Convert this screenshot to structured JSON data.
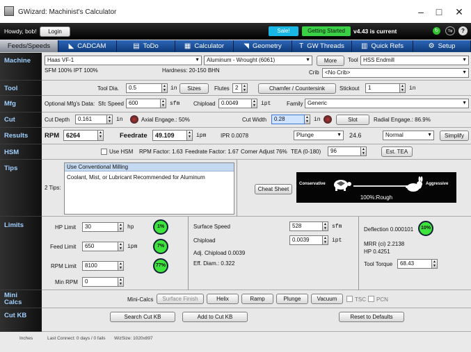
{
  "window": {
    "title": "GWizard: Machinist's Calculator"
  },
  "topbar": {
    "greeting": "Howdy, bob!",
    "login": "Login",
    "sale": "Sale!",
    "getting_started": "Getting Started",
    "version": "v4.43 is current"
  },
  "tabs": [
    {
      "label": "Feeds/Speeds",
      "icon": ""
    },
    {
      "label": "CADCAM",
      "icon": "◣"
    },
    {
      "label": "ToDo",
      "icon": "▤"
    },
    {
      "label": "Calculator",
      "icon": "▦"
    },
    {
      "label": "Geometry",
      "icon": "◥"
    },
    {
      "label": "GW Threads",
      "icon": "T"
    },
    {
      "label": "Quick Refs",
      "icon": "▥"
    },
    {
      "label": "Setup",
      "icon": "⚙"
    }
  ],
  "sections": {
    "machine": "Machine",
    "tool": "Tool",
    "mfg": "Mfg",
    "cut": "Cut",
    "results": "Results",
    "hsm": "HSM",
    "tips": "Tips",
    "limits": "Limits",
    "mini1": "Mini",
    "mini2": "Calcs",
    "cutkb": "Cut KB"
  },
  "machine": {
    "machine_value": "Haas VF-1",
    "material_value": "Aluminum - Wrought (6061)",
    "more": "More",
    "tool_label": "Tool",
    "tool_value": "HSS Endmill",
    "crib_label": "Crib",
    "crib_value": "<No Crib>",
    "sfm_ipt": "SFM 100%  IPT 100%",
    "hardness": "Hardness: 20-150 BHN"
  },
  "tool": {
    "dia_label": "Tool Dia.",
    "dia_value": "0.5",
    "dia_unit": "in",
    "sizes": "Sizes",
    "flutes_label": "Flutes",
    "flutes_value": "2",
    "chamfer": "Chamfer / Countersink",
    "stickout_label": "Stickout",
    "stickout_value": "1",
    "stickout_unit": "in"
  },
  "mfg": {
    "opt_label": "Optional Mfg's Data:",
    "sfc_label": "Sfc Speed",
    "sfc_value": "600",
    "sfc_unit": "sfm",
    "chipload_label": "Chipload",
    "chipload_value": "0.0049",
    "chipload_unit": "ipt",
    "family_label": "Family",
    "family_value": "Generic"
  },
  "cut": {
    "depth_label": "Cut Depth",
    "depth_value": "0.161",
    "depth_unit": "in",
    "axial": "Axial Engage.: 50%",
    "width_label": "Cut Width",
    "width_value": "0.28",
    "width_unit": "in",
    "slot": "Slot",
    "radial": "Radial Engage.: 86.9%"
  },
  "results": {
    "rpm_label": "RPM",
    "rpm_value": "6264",
    "feed_label": "Feedrate",
    "feed_value": "49.109",
    "feed_unit": "ipm",
    "ipr": "IPR 0.0078",
    "plunge_value": "Plunge",
    "plunge_num": "24.6",
    "normal_value": "Normal",
    "simplify": "Simplify"
  },
  "hsm": {
    "use_hsm": "Use HSM",
    "rpm_factor": "RPM Factor: 1.63",
    "feed_factor": "Feedrate Factor: 1.67",
    "corner": "Corner Adjust 76%",
    "tea_label": "TEA (0-180)",
    "tea_value": "96",
    "est_tea": "Est. TEA"
  },
  "tips": {
    "count": "2 Tips:",
    "items": [
      "Use Conventional Milling",
      "Coolant, Mist, or Lubricant Recommended for Aluminum"
    ],
    "cheat": "Cheat Sheet",
    "conservative": "Conservative",
    "aggressive": "Aggressive",
    "slider_text": "100%:Rough",
    "slider_level": 1.0
  },
  "limits": {
    "hp_label": "HP Limit",
    "hp_value": "30",
    "hp_unit": "hp",
    "hp_pct": "1%",
    "feed_label": "Feed Limit",
    "feed_value": "650",
    "feed_unit": "ipm",
    "feed_pct": "7%",
    "rpm_label": "RPM Limit",
    "rpm_value": "8100",
    "rpm_pct": "77%",
    "minrpm_label": "Min RPM",
    "minrpm_value": "0",
    "surf_label": "Surface Speed",
    "surf_value": "528",
    "surf_unit": "sfm",
    "chip_label": "Chipload",
    "chip_value": "0.0039",
    "chip_unit": "ipt",
    "adj": "Adj. Chipload 0.0039",
    "eff": "Eff. Diam.: 0.322",
    "deflection": "Deflection 0.000101",
    "defl_pct": "10%",
    "mrr": "MRR (ci) 2.2138",
    "hp": "HP 0.4251",
    "torque_label": "Tool Torque",
    "torque_value": "68.43"
  },
  "mini": {
    "label": "Mini-Calcs",
    "surface": "Surface Finish",
    "helix": "Helix",
    "ramp": "Ramp",
    "plunge": "Plunge",
    "vacuum": "Vacuum",
    "tsc": "TSC",
    "pcn": "PCN"
  },
  "cutkb": {
    "search": "Search Cut KB",
    "add": "Add to Cut KB",
    "reset": "Reset to Defaults"
  },
  "status": {
    "units": "Inches",
    "last": "Last Connect: 0 days / 0 fails",
    "wiz": "WizSize: 1020x897"
  }
}
